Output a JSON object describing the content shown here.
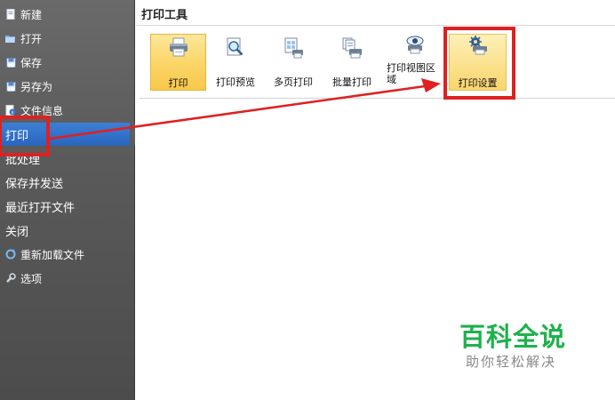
{
  "sidebar": {
    "items": [
      {
        "label": "新建",
        "icon": "new-file-icon"
      },
      {
        "label": "打开",
        "icon": "open-folder-icon"
      },
      {
        "label": "保存",
        "icon": "save-disk-icon"
      },
      {
        "label": "另存为",
        "icon": "save-as-icon"
      },
      {
        "label": "文件信息",
        "icon": "file-info-icon"
      },
      {
        "label": "打印"
      },
      {
        "label": "批处理"
      },
      {
        "label": "保存并发送"
      },
      {
        "label": "最近打开文件"
      },
      {
        "label": "关闭"
      },
      {
        "label": "重新加载文件",
        "icon": "reload-icon"
      },
      {
        "label": "选项",
        "icon": "options-wrench-icon"
      }
    ],
    "selected_index": 5
  },
  "main": {
    "section_title": "打印工具",
    "tools": [
      {
        "label": "打印",
        "icon": "printer-icon"
      },
      {
        "label": "打印预览",
        "icon": "print-preview-icon"
      },
      {
        "label": "多页打印",
        "icon": "multi-page-print-icon"
      },
      {
        "label": "批量打印",
        "icon": "batch-print-icon"
      },
      {
        "label": "打印视图区域",
        "icon": "print-view-area-icon"
      },
      {
        "label": "打印设置",
        "icon": "print-settings-icon"
      }
    ]
  },
  "watermark": {
    "title": "百科全说",
    "subtitle": "助你轻松解决"
  },
  "colors": {
    "sidebar_bg": "#5a5a5a",
    "selected_bg": "#2f6ec6",
    "annotation_red": "#e02020",
    "watermark_green": "#1eb14c"
  }
}
